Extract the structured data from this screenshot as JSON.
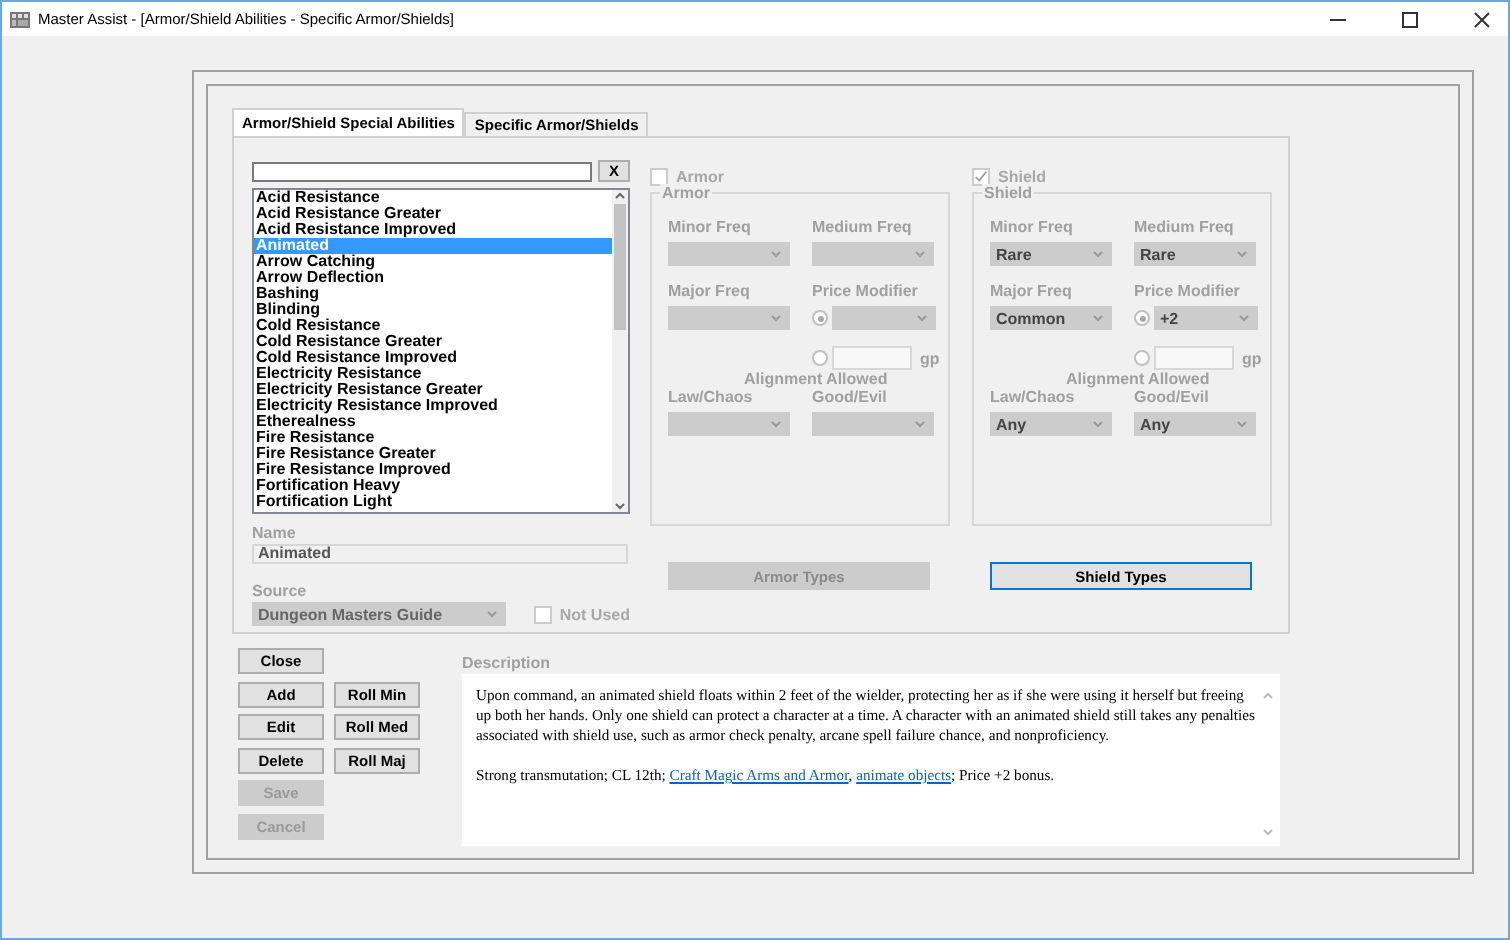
{
  "window": {
    "title": "Master Assist - [Armor/Shield Abilities - Specific Armor/Shields]"
  },
  "tabs": [
    {
      "label": "Armor/Shield Special Abilities",
      "selected": true
    },
    {
      "label": "Specific Armor/Shields",
      "selected": false
    }
  ],
  "search": {
    "clear_label": "X"
  },
  "abilities": [
    {
      "label": "Acid Resistance",
      "selected": false
    },
    {
      "label": "Acid Resistance Greater",
      "selected": false
    },
    {
      "label": "Acid Resistance Improved",
      "selected": false
    },
    {
      "label": "Animated",
      "selected": true
    },
    {
      "label": "Arrow Catching",
      "selected": false
    },
    {
      "label": "Arrow Deflection",
      "selected": false
    },
    {
      "label": "Bashing",
      "selected": false
    },
    {
      "label": "Blinding",
      "selected": false
    },
    {
      "label": "Cold Resistance",
      "selected": false
    },
    {
      "label": "Cold Resistance Greater",
      "selected": false
    },
    {
      "label": "Cold Resistance Improved",
      "selected": false
    },
    {
      "label": "Electricity Resistance",
      "selected": false
    },
    {
      "label": "Electricity Resistance Greater",
      "selected": false
    },
    {
      "label": "Electricity Resistance Improved",
      "selected": false
    },
    {
      "label": "Etherealness",
      "selected": false
    },
    {
      "label": "Fire Resistance",
      "selected": false
    },
    {
      "label": "Fire Resistance Greater",
      "selected": false
    },
    {
      "label": "Fire Resistance Improved",
      "selected": false
    },
    {
      "label": "Fortification Heavy",
      "selected": false
    },
    {
      "label": "Fortification Light",
      "selected": false
    }
  ],
  "name": {
    "label": "Name",
    "value": "Animated"
  },
  "source": {
    "label": "Source",
    "value": "Dungeon Masters Guide"
  },
  "not_used": {
    "label": "Not Used",
    "checked": false,
    "disabled": true
  },
  "groups": [
    {
      "checkbox": {
        "label": "Armor",
        "checked": false,
        "disabled": true
      },
      "title": "Armor",
      "freq": [
        {
          "label": "Minor Freq"
        },
        {
          "label": "Medium Freq"
        },
        {
          "label": "Major Freq"
        }
      ],
      "price": {
        "label": "Price Modifier",
        "modifier_selected": true,
        "gp_selected": false,
        "unit": "gp"
      },
      "alignment_title": "Alignment Allowed",
      "alignment": [
        {
          "label": "Law/Chaos"
        },
        {
          "label": "Good/Evil"
        }
      ],
      "button": {
        "label": "Armor Types",
        "disabled": true,
        "focused": false
      }
    },
    {
      "checkbox": {
        "label": "Shield",
        "checked": true,
        "disabled": true
      },
      "title": "Shield",
      "freq": [
        {
          "label": "Minor Freq",
          "value": "Rare"
        },
        {
          "label": "Medium Freq",
          "value": "Rare"
        },
        {
          "label": "Major Freq",
          "value": "Common"
        }
      ],
      "price": {
        "label": "Price Modifier",
        "value": "+2",
        "modifier_selected": true,
        "gp_selected": false,
        "unit": "gp"
      },
      "alignment_title": "Alignment Allowed",
      "alignment": [
        {
          "label": "Law/Chaos",
          "value": "Any"
        },
        {
          "label": "Good/Evil",
          "value": "Any"
        }
      ],
      "button": {
        "label": "Shield Types",
        "disabled": false,
        "focused": true
      }
    }
  ],
  "buttons": [
    {
      "label": "Close",
      "disabled": false
    },
    {
      "label": "Add",
      "disabled": false
    },
    {
      "label": "Roll Min",
      "disabled": false
    },
    {
      "label": "Edit",
      "disabled": false
    },
    {
      "label": "Roll Med",
      "disabled": false
    },
    {
      "label": "Delete",
      "disabled": false
    },
    {
      "label": "Roll Maj",
      "disabled": false
    },
    {
      "label": "Save",
      "disabled": true
    },
    {
      "label": "Cancel",
      "disabled": true
    }
  ],
  "description": {
    "label": "Description",
    "paragraphs": [
      [
        {
          "text": "Upon command, an animated shield floats within 2 feet of the wielder, protecting her as if she were using it herself but freeing up both her hands. Only one shield can protect a character at a time. A character with an animated shield still takes any penalties associated with shield use, such as armor check penalty, arcane spell failure chance, and nonproficiency.",
          "link": false
        }
      ],
      [
        {
          "text": "Strong transmutation; CL 12th; ",
          "link": false
        },
        {
          "text": "Craft Magic Arms and Armor",
          "link": true
        },
        {
          "text": ", ",
          "link": false
        },
        {
          "text": "animate objects",
          "link": true
        },
        {
          "text": "; Price +2 bonus.",
          "link": false
        }
      ]
    ]
  }
}
